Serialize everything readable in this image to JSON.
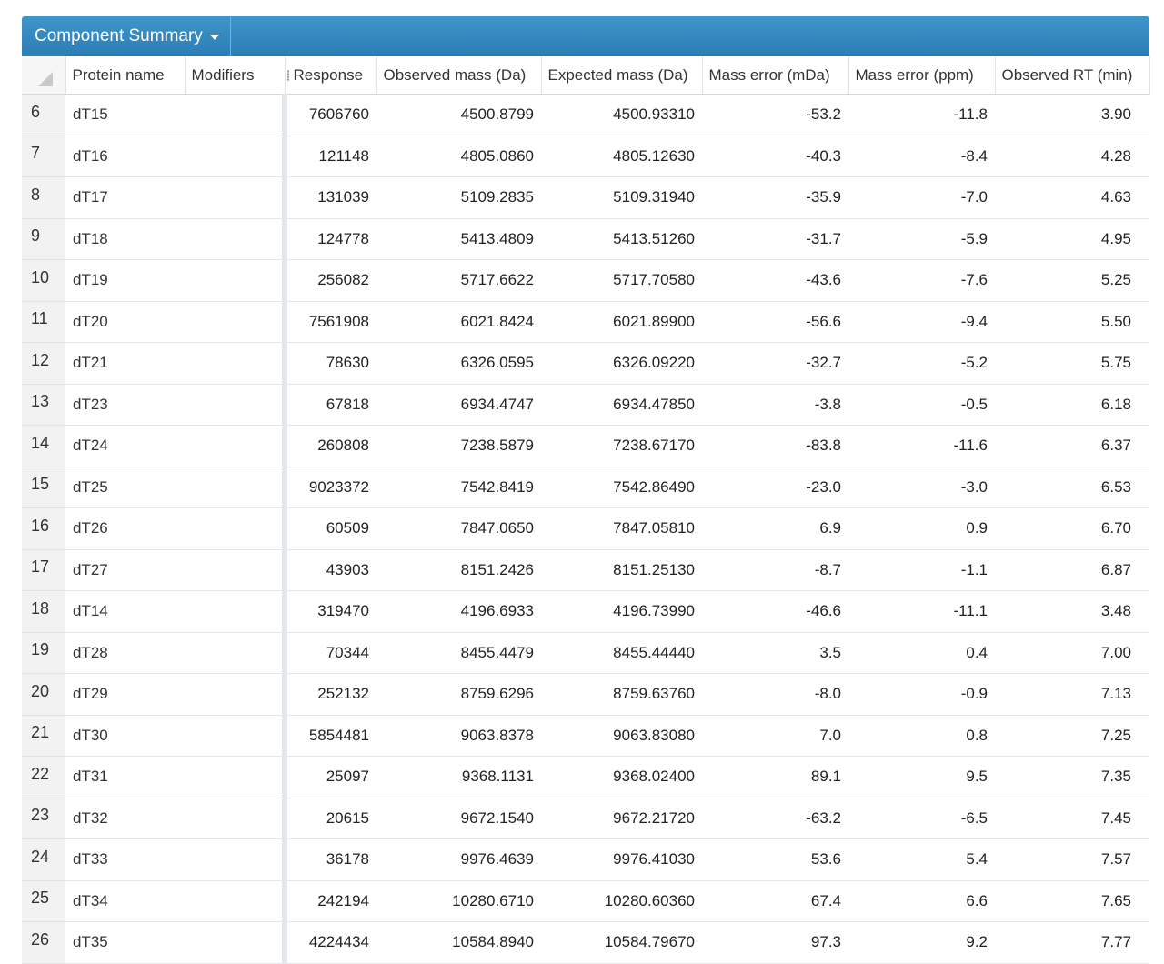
{
  "header": {
    "title": "Component Summary"
  },
  "table": {
    "columns": [
      "Protein name",
      "Modifiers",
      "Response",
      "Observed mass (Da)",
      "Expected mass (Da)",
      "Mass error (mDa)",
      "Mass error (ppm)",
      "Observed RT (min)"
    ],
    "rows": [
      [
        "6",
        "dT15",
        "",
        "7606760",
        "4500.8799",
        "4500.93310",
        "-53.2",
        "-11.8",
        "3.90"
      ],
      [
        "7",
        "dT16",
        "",
        "121148",
        "4805.0860",
        "4805.12630",
        "-40.3",
        "-8.4",
        "4.28"
      ],
      [
        "8",
        "dT17",
        "",
        "131039",
        "5109.2835",
        "5109.31940",
        "-35.9",
        "-7.0",
        "4.63"
      ],
      [
        "9",
        "dT18",
        "",
        "124778",
        "5413.4809",
        "5413.51260",
        "-31.7",
        "-5.9",
        "4.95"
      ],
      [
        "10",
        "dT19",
        "",
        "256082",
        "5717.6622",
        "5717.70580",
        "-43.6",
        "-7.6",
        "5.25"
      ],
      [
        "11",
        "dT20",
        "",
        "7561908",
        "6021.8424",
        "6021.89900",
        "-56.6",
        "-9.4",
        "5.50"
      ],
      [
        "12",
        "dT21",
        "",
        "78630",
        "6326.0595",
        "6326.09220",
        "-32.7",
        "-5.2",
        "5.75"
      ],
      [
        "13",
        "dT23",
        "",
        "67818",
        "6934.4747",
        "6934.47850",
        "-3.8",
        "-0.5",
        "6.18"
      ],
      [
        "14",
        "dT24",
        "",
        "260808",
        "7238.5879",
        "7238.67170",
        "-83.8",
        "-11.6",
        "6.37"
      ],
      [
        "15",
        "dT25",
        "",
        "9023372",
        "7542.8419",
        "7542.86490",
        "-23.0",
        "-3.0",
        "6.53"
      ],
      [
        "16",
        "dT26",
        "",
        "60509",
        "7847.0650",
        "7847.05810",
        "6.9",
        "0.9",
        "6.70"
      ],
      [
        "17",
        "dT27",
        "",
        "43903",
        "8151.2426",
        "8151.25130",
        "-8.7",
        "-1.1",
        "6.87"
      ],
      [
        "18",
        "dT14",
        "",
        "319470",
        "4196.6933",
        "4196.73990",
        "-46.6",
        "-11.1",
        "3.48"
      ],
      [
        "19",
        "dT28",
        "",
        "70344",
        "8455.4479",
        "8455.44440",
        "3.5",
        "0.4",
        "7.00"
      ],
      [
        "20",
        "dT29",
        "",
        "252132",
        "8759.6296",
        "8759.63760",
        "-8.0",
        "-0.9",
        "7.13"
      ],
      [
        "21",
        "dT30",
        "",
        "5854481",
        "9063.8378",
        "9063.83080",
        "7.0",
        "0.8",
        "7.25"
      ],
      [
        "22",
        "dT31",
        "",
        "25097",
        "9368.1131",
        "9368.02400",
        "89.1",
        "9.5",
        "7.35"
      ],
      [
        "23",
        "dT32",
        "",
        "20615",
        "9672.1540",
        "9672.21720",
        "-63.2",
        "-6.5",
        "7.45"
      ],
      [
        "24",
        "dT33",
        "",
        "36178",
        "9976.4639",
        "9976.41030",
        "53.6",
        "5.4",
        "7.57"
      ],
      [
        "25",
        "dT34",
        "",
        "242194",
        "10280.6710",
        "10280.60360",
        "67.4",
        "6.6",
        "7.65"
      ],
      [
        "26",
        "dT35",
        "",
        "4224434",
        "10584.8940",
        "10584.79670",
        "97.3",
        "9.2",
        "7.77"
      ]
    ]
  }
}
